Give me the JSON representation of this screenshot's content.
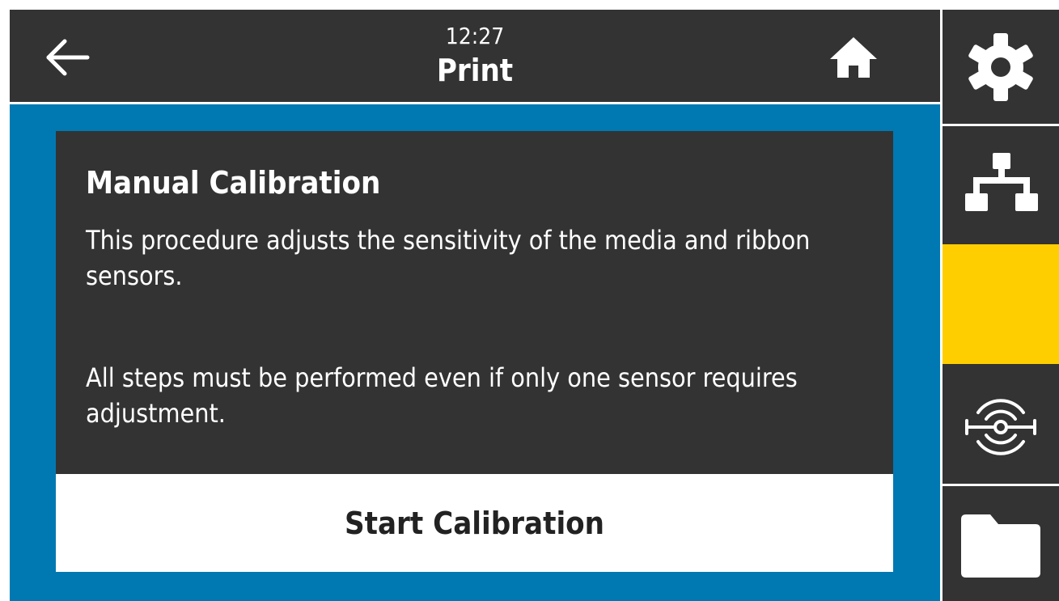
{
  "header": {
    "time": "12:27",
    "title": "Print",
    "back_icon": "arrow-left-icon",
    "home_icon": "home-icon"
  },
  "card": {
    "title": "Manual Calibration",
    "text1": "This procedure adjusts the sensitivity of the media and ribbon sensors.",
    "text2": "All steps must be performed even if only one sensor requires adjustment.",
    "button_label": "Start Calibration"
  },
  "sidebar": {
    "items": [
      {
        "icon": "gear-icon",
        "active": false
      },
      {
        "icon": "network-icon",
        "active": false
      },
      {
        "icon": "print-icon",
        "active": true
      },
      {
        "icon": "rfid-icon",
        "active": false
      },
      {
        "icon": "folder-icon",
        "active": false
      }
    ]
  },
  "colors": {
    "background_dark": "#333333",
    "accent_blue": "#0079B2",
    "active_yellow": "#FFCE00",
    "text_light": "#FFFFFF"
  }
}
